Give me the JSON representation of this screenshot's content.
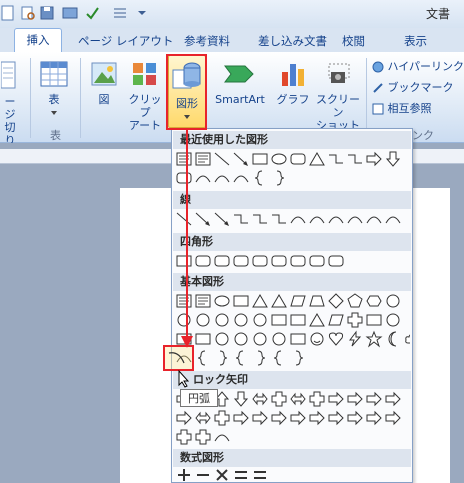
{
  "window": {
    "title": "文書"
  },
  "tabs": [
    {
      "label": "挿入",
      "active": true
    },
    {
      "label": "ページ レイアウト"
    },
    {
      "label": "参考資料"
    },
    {
      "label": "差し込み文書"
    },
    {
      "label": "校閲"
    },
    {
      "label": "表示"
    }
  ],
  "ribbon": {
    "page_fragment": "ージ",
    "page_fragment2": "切り",
    "table": "表",
    "table_group": "表",
    "picture": "図",
    "clipart_1": "クリップ",
    "clipart_2": "アート",
    "shapes": "図形",
    "smartart": "SmartArt",
    "chart": "グラフ",
    "screenshot_1": "スクリーン",
    "screenshot_2": "ショット",
    "hyperlink": "ハイパーリンク",
    "bookmark": "ブックマーク",
    "crossref": "相互参照",
    "links_group_fragment": "ンク"
  },
  "menu": {
    "recent": "最近使用した図形",
    "lines": "線",
    "rectangles": "四角形",
    "basic": "基本図形",
    "block_arrows": "ロック矢印",
    "equation": "数式図形"
  },
  "tooltip": "円弧",
  "colors": {
    "highlight": "#e8232b",
    "accent": "#15428b"
  }
}
